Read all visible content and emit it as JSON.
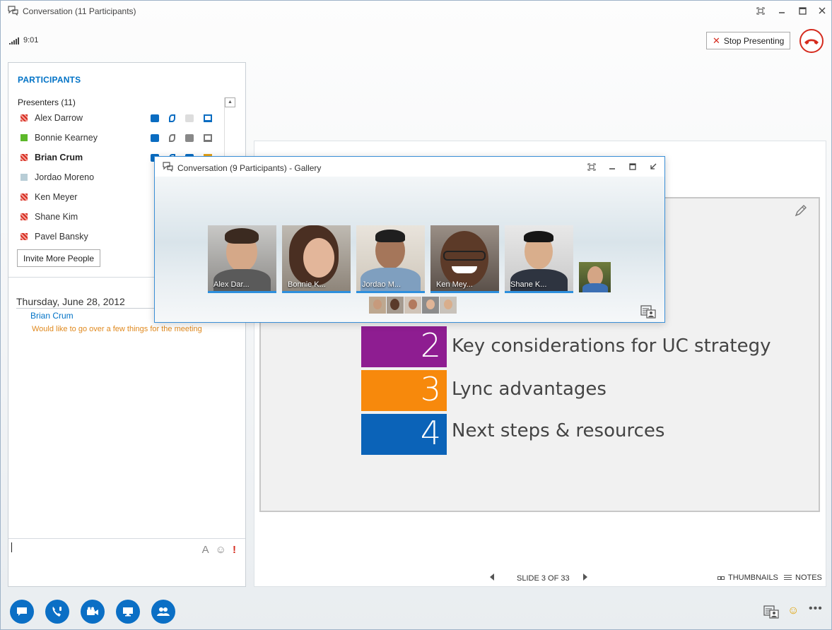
{
  "window": {
    "title": "Conversation (11 Participants)"
  },
  "signal": {
    "duration": "9:01"
  },
  "header": {
    "stop_presenting": "Stop Presenting"
  },
  "participants": {
    "heading": "PARTICIPANTS",
    "group_label": "Presenters (11)",
    "list": [
      {
        "name": "Alex Darrow",
        "status": "busy"
      },
      {
        "name": "Bonnie Kearney",
        "status": "available"
      },
      {
        "name": "Brian Crum",
        "status": "busy"
      },
      {
        "name": "Jordao Moreno",
        "status": "away"
      },
      {
        "name": "Ken Meyer",
        "status": "busy"
      },
      {
        "name": "Shane Kim",
        "status": "busy"
      },
      {
        "name": "Pavel Bansky",
        "status": "busy"
      }
    ],
    "invite_label": "Invite More People"
  },
  "chat": {
    "date": "Thursday, June 28, 2012",
    "sender": "Brian Crum",
    "message": "Would like to go over a few things for the meeting"
  },
  "gallery": {
    "title": "Conversation (9 Participants) - Gallery",
    "tiles": [
      {
        "caption": "Alex Dar..."
      },
      {
        "caption": "Bonnie K..."
      },
      {
        "caption": "Jordao M..."
      },
      {
        "caption": "Ken Mey..."
      },
      {
        "caption": "Shane K..."
      }
    ]
  },
  "slide": {
    "items": [
      {
        "number": "2",
        "text": "Key considerations for UC strategy",
        "color": "#8e1d91"
      },
      {
        "number": "3",
        "text": "Lync advantages",
        "color": "#f7890c"
      },
      {
        "number": "4",
        "text": "Next steps & resources",
        "color": "#0b63b8"
      }
    ]
  },
  "slide_nav": {
    "counter": "SLIDE 3 OF 33",
    "thumbnails_label": "THUMBNAILS",
    "notes_label": "NOTES"
  },
  "colors": {
    "accent": "#0b6fc5",
    "hangup": "#d52b1e"
  }
}
